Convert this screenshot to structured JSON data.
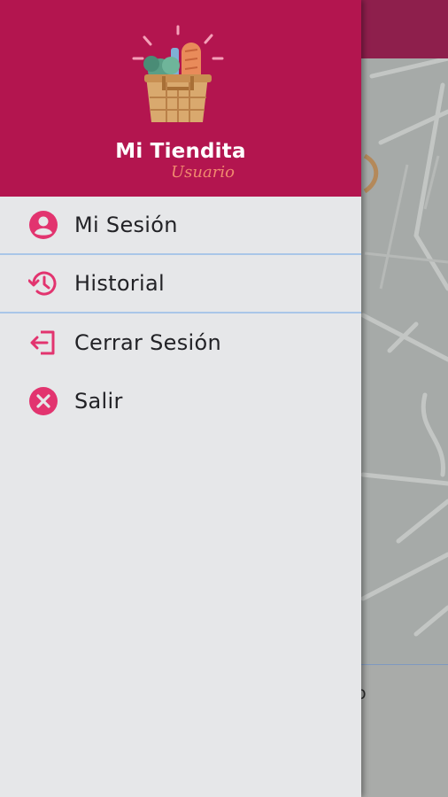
{
  "app": {
    "name": "Mi Tiendita",
    "subtitle": "Usuario"
  },
  "menu": {
    "items": [
      {
        "label": "Mi Sesión",
        "icon": "account-circle-icon"
      },
      {
        "label": "Historial",
        "icon": "history-icon"
      },
      {
        "label": "Cerrar Sesión",
        "icon": "logout-icon"
      },
      {
        "label": "Salir",
        "icon": "close-circle-icon"
      }
    ]
  },
  "background": {
    "partial_text": "o"
  },
  "colors": {
    "header": "#b3154f",
    "icon_accent": "#e2346f",
    "drawer_bg": "#e6e7e9",
    "divider": "#a9c6e8"
  }
}
